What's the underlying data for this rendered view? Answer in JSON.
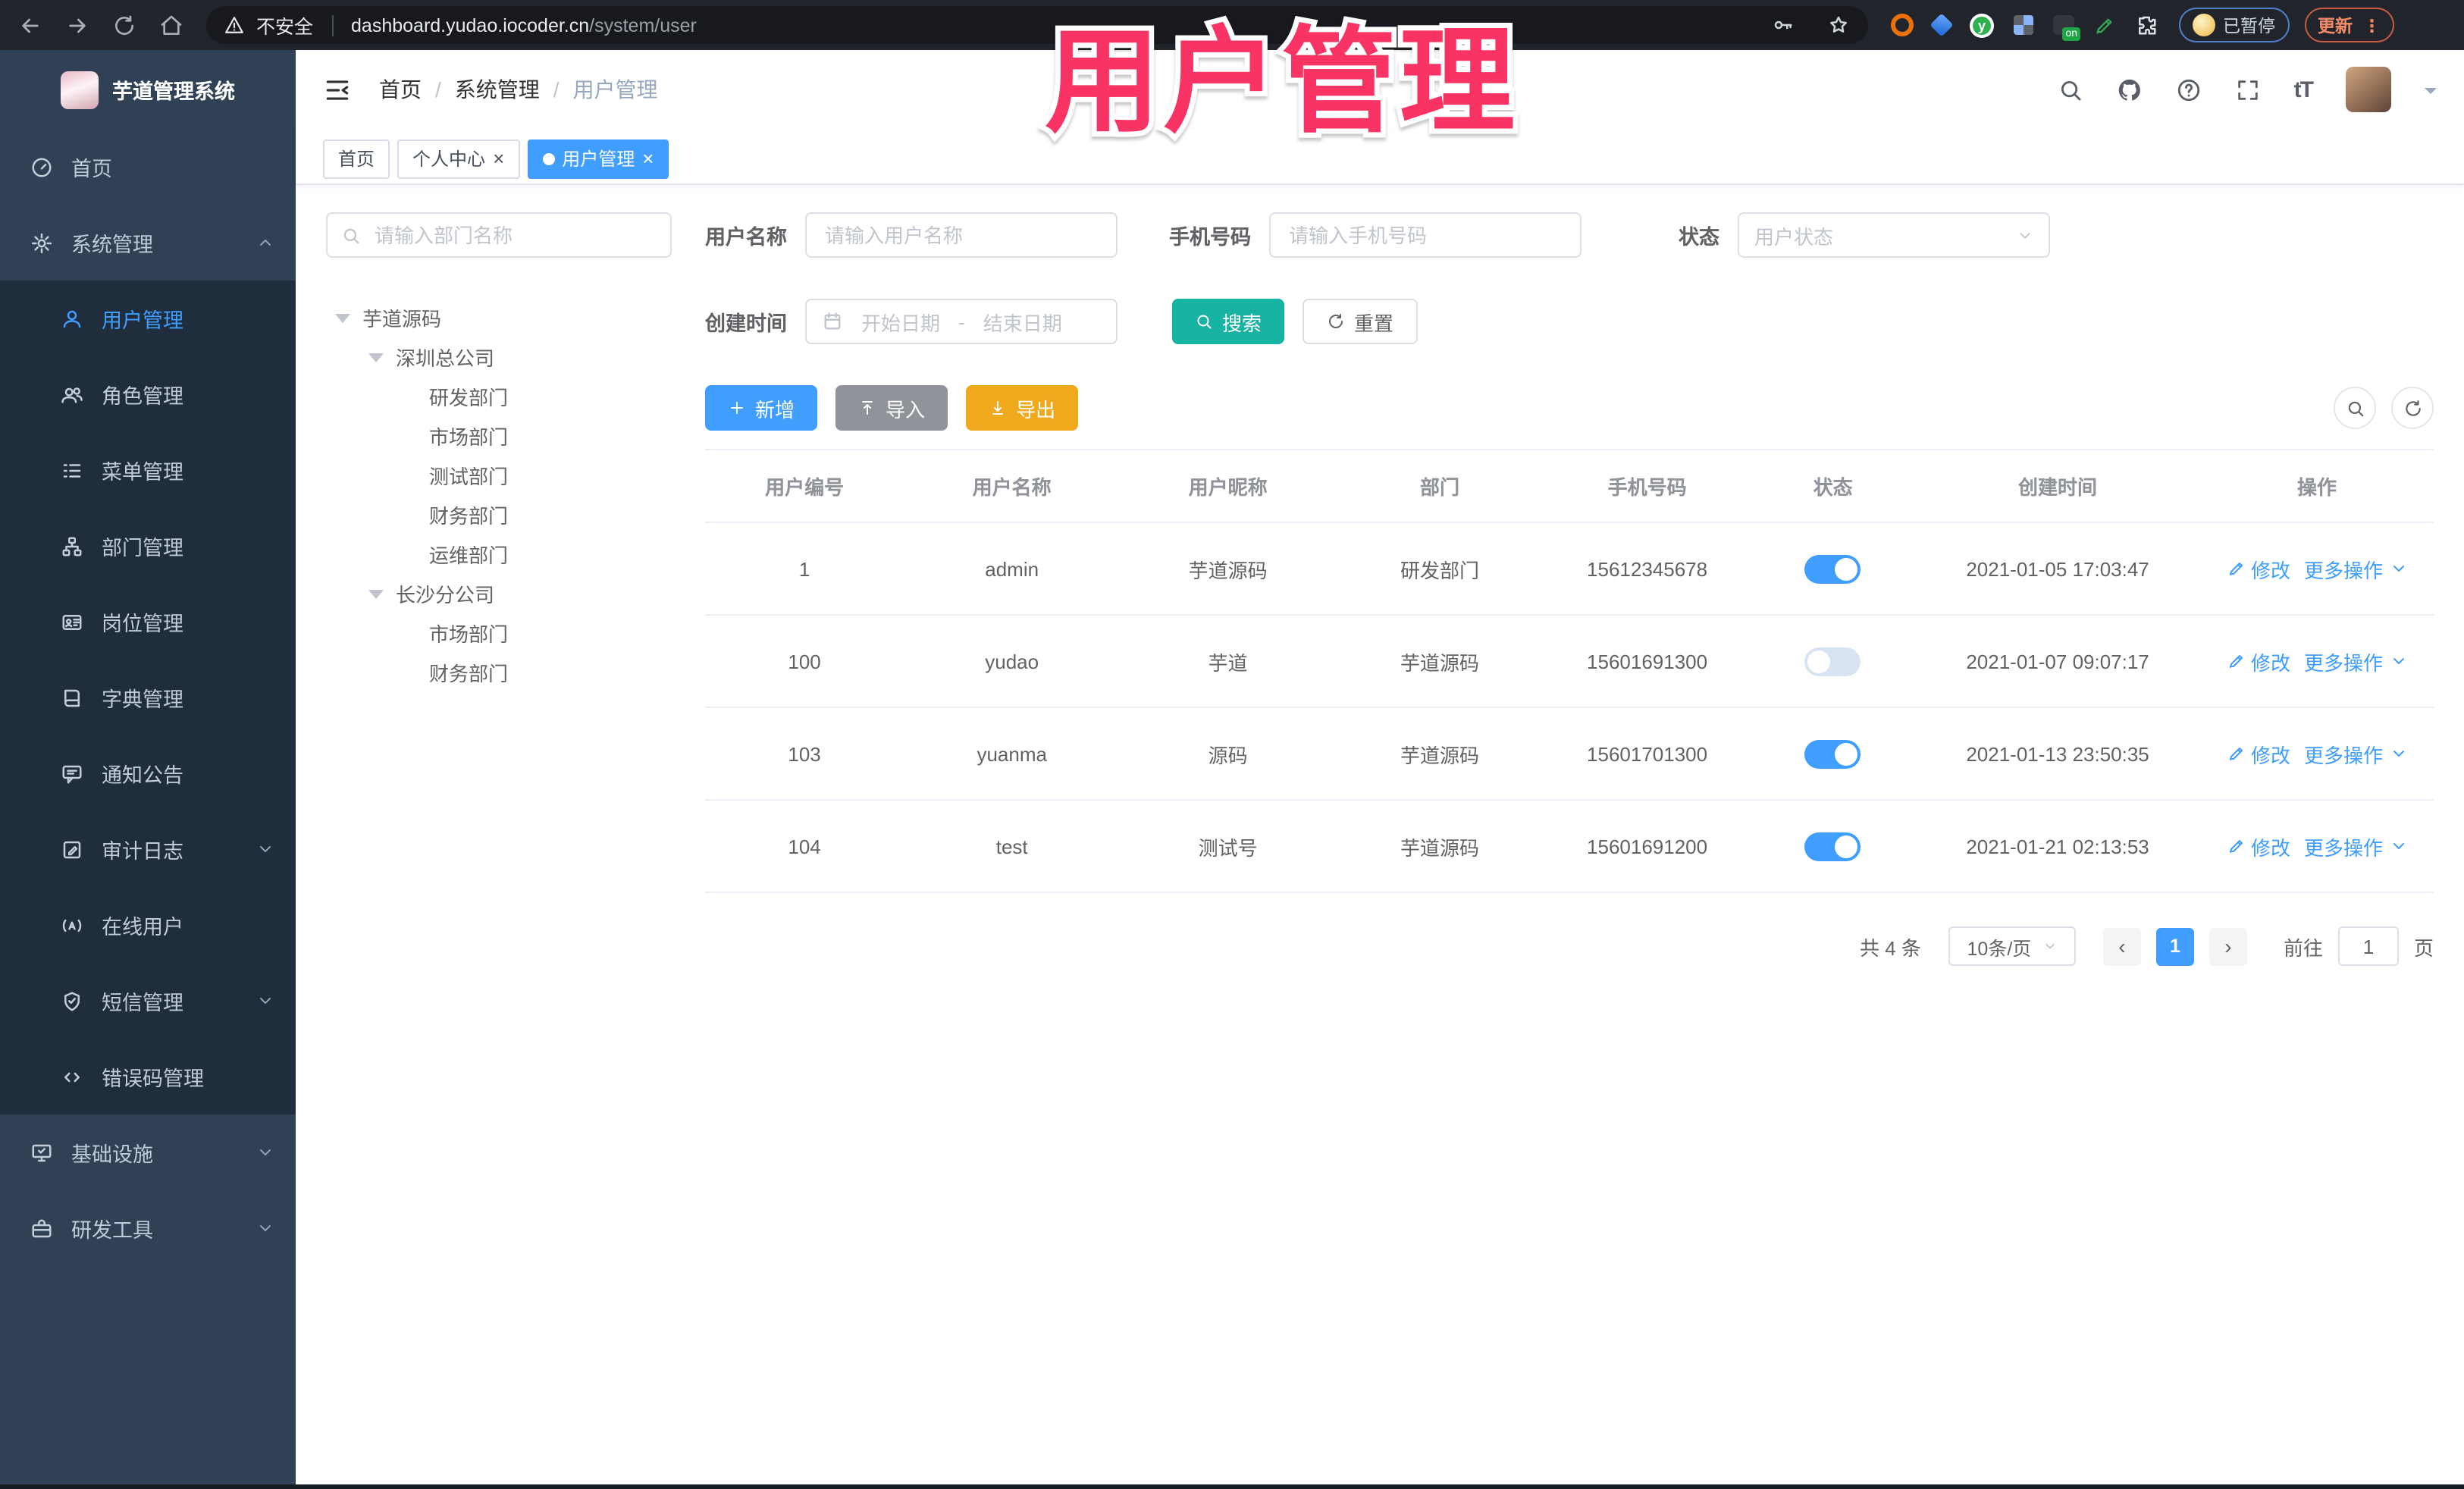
{
  "colors": {
    "accent": "#409eff",
    "search_button": "#17b3a3",
    "export_button": "#f0a81c",
    "import_button": "#909399",
    "overlay_pink": "#f93364",
    "sidebar_bg": "#304156",
    "submenu_bg": "#1f2d3d"
  },
  "browser": {
    "security_warning": "不安全",
    "url_host": "dashboard.yudao.iocoder.cn",
    "url_path": "/system/user",
    "paused_badge": "已暂停",
    "update_label": "更新",
    "action_icons": [
      "back",
      "forward",
      "reload",
      "home",
      "key",
      "star"
    ],
    "extension_icons": [
      "orange-ring",
      "blue-gem",
      "green-y",
      "grid",
      "on-badge",
      "green-pen",
      "puzzle"
    ]
  },
  "overlay": {
    "title": "用户管理"
  },
  "sidebar": {
    "logo_title": "芋道管理系统",
    "items": [
      {
        "name": "home",
        "label": "首页",
        "icon": "gauge",
        "level": "top"
      },
      {
        "name": "system",
        "label": "系统管理",
        "icon": "gear",
        "level": "top",
        "chevron": "up"
      },
      {
        "name": "user-mgmt",
        "label": "用户管理",
        "icon": "user",
        "level": "sub",
        "active": true
      },
      {
        "name": "role-mgmt",
        "label": "角色管理",
        "icon": "users",
        "level": "sub"
      },
      {
        "name": "menu-mgmt",
        "label": "菜单管理",
        "icon": "menu-tree",
        "level": "sub"
      },
      {
        "name": "dept-mgmt",
        "label": "部门管理",
        "icon": "org",
        "level": "sub"
      },
      {
        "name": "post-mgmt",
        "label": "岗位管理",
        "icon": "idcard",
        "level": "sub"
      },
      {
        "name": "dict-mgmt",
        "label": "字典管理",
        "icon": "book",
        "level": "sub"
      },
      {
        "name": "notice",
        "label": "通知公告",
        "icon": "megaphone",
        "level": "sub"
      },
      {
        "name": "audit-log",
        "label": "审计日志",
        "icon": "edit-log",
        "level": "sub",
        "chevron": "down"
      },
      {
        "name": "online-users",
        "label": "在线用户",
        "icon": "online",
        "level": "sub"
      },
      {
        "name": "sms-mgmt",
        "label": "短信管理",
        "icon": "shield-check",
        "level": "sub",
        "chevron": "down"
      },
      {
        "name": "error-code",
        "label": "错误码管理",
        "icon": "code",
        "level": "sub"
      },
      {
        "name": "infrastructure",
        "label": "基础设施",
        "icon": "monitor",
        "level": "top",
        "chevron": "down"
      },
      {
        "name": "dev-tools",
        "label": "研发工具",
        "icon": "toolbox",
        "level": "top",
        "chevron": "down"
      }
    ]
  },
  "header": {
    "breadcrumb": [
      "首页",
      "系统管理",
      "用户管理"
    ],
    "font_icon_text": "tT",
    "icons": [
      "search",
      "github",
      "question",
      "fullscreen",
      "font-size",
      "avatar",
      "caret-down"
    ]
  },
  "tabs": [
    {
      "name": "home",
      "label": "首页"
    },
    {
      "name": "profile",
      "label": "个人中心",
      "closable": true
    },
    {
      "name": "user-mgmt",
      "label": "用户管理",
      "closable": true,
      "active": true
    }
  ],
  "dept_panel": {
    "search_placeholder": "请输入部门名称",
    "tree": [
      {
        "label": "芋道源码",
        "depth": 0,
        "arrow": true
      },
      {
        "label": "深圳总公司",
        "depth": 1,
        "arrow": true
      },
      {
        "label": "研发部门",
        "depth": 2
      },
      {
        "label": "市场部门",
        "depth": 2
      },
      {
        "label": "测试部门",
        "depth": 2
      },
      {
        "label": "财务部门",
        "depth": 2
      },
      {
        "label": "运维部门",
        "depth": 2
      },
      {
        "label": "长沙分公司",
        "depth": 1,
        "arrow": true
      },
      {
        "label": "市场部门",
        "depth": 2
      },
      {
        "label": "财务部门",
        "depth": 2
      }
    ]
  },
  "filters": {
    "username_label": "用户名称",
    "username_placeholder": "请输入用户名称",
    "mobile_label": "手机号码",
    "mobile_placeholder": "请输入手机号码",
    "status_label": "状态",
    "status_placeholder": "用户状态",
    "create_time_label": "创建时间",
    "start_placeholder": "开始日期",
    "range_separator": "-",
    "end_placeholder": "结束日期",
    "search_label": "搜索",
    "reset_label": "重置"
  },
  "toolbar": {
    "add_label": "新增",
    "import_label": "导入",
    "export_label": "导出"
  },
  "table": {
    "columns": [
      "用户编号",
      "用户名称",
      "用户昵称",
      "部门",
      "手机号码",
      "状态",
      "创建时间",
      "操作"
    ],
    "edit_label": "修改",
    "more_label": "更多操作",
    "rows": [
      {
        "id": "1",
        "username": "admin",
        "nickname": "芋道源码",
        "dept": "研发部门",
        "mobile": "15612345678",
        "status_on": true,
        "created": "2021-01-05 17:03:47"
      },
      {
        "id": "100",
        "username": "yudao",
        "nickname": "芋道",
        "dept": "芋道源码",
        "mobile": "15601691300",
        "status_on": false,
        "created": "2021-01-07 09:07:17"
      },
      {
        "id": "103",
        "username": "yuanma",
        "nickname": "源码",
        "dept": "芋道源码",
        "mobile": "15601701300",
        "status_on": true,
        "created": "2021-01-13 23:50:35"
      },
      {
        "id": "104",
        "username": "test",
        "nickname": "测试号",
        "dept": "芋道源码",
        "mobile": "15601691200",
        "status_on": true,
        "created": "2021-01-21 02:13:53"
      }
    ]
  },
  "pagination": {
    "total_label": "共 4 条",
    "page_size_label": "10条/页",
    "current_page": "1",
    "goto_label": "前往",
    "goto_value": "1",
    "page_unit": "页"
  }
}
